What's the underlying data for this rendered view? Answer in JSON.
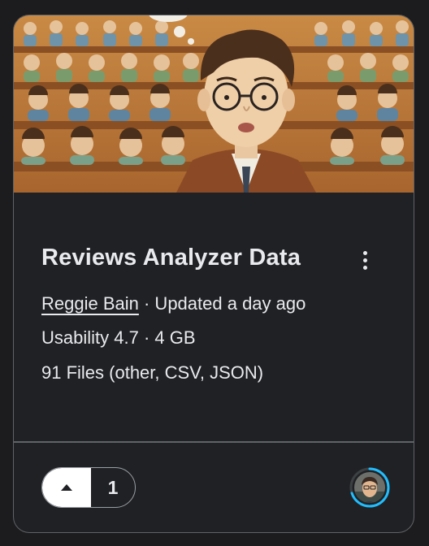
{
  "card": {
    "title": "Reviews Analyzer Data",
    "author": "Reggie Bain",
    "updated": " · Updated a day ago",
    "usability_line": "Usability 4.7 · 4 GB",
    "files_line": "91 Files (other, CSV, JSON)",
    "more_icon": "more-vertical-icon",
    "thumbnail": "illustration-classroom-teacher"
  },
  "vote": {
    "icon": "upvote-triangle-icon",
    "count": "1"
  },
  "avatar": {
    "ring_color": "#20beff",
    "progress": 0.7
  },
  "colors": {
    "card_bg": "#202124",
    "border": "#5f6368",
    "text": "#e8eaed"
  }
}
